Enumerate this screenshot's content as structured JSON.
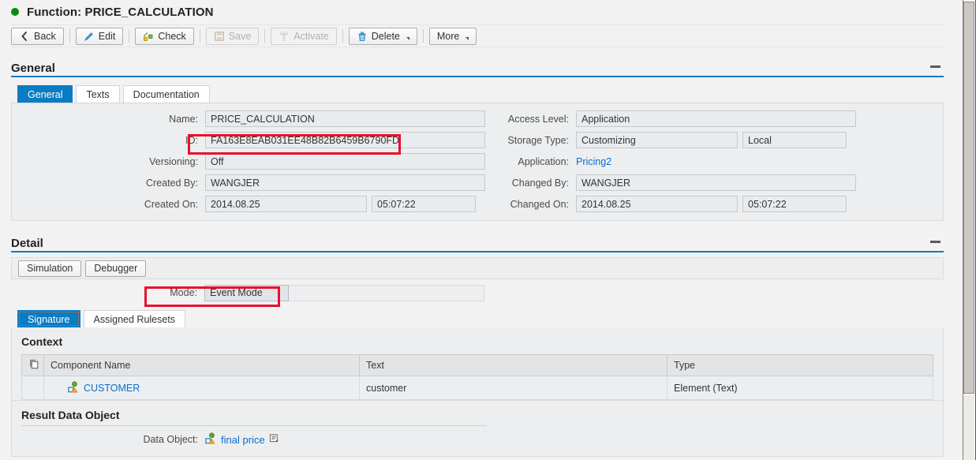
{
  "page": {
    "status_icon": "green-status-dot",
    "title": "Function: PRICE_CALCULATION"
  },
  "toolbar": {
    "buttons": [
      {
        "label": "Back",
        "icon": "back-chevron-icon",
        "disabled": false,
        "dropdown": false
      },
      {
        "label": "Edit",
        "icon": "pencil-icon",
        "disabled": false,
        "dropdown": false
      },
      {
        "label": "Check",
        "icon": "check-tool-icon",
        "disabled": false,
        "dropdown": false
      },
      {
        "label": "Save",
        "icon": "floppy-disk-icon",
        "disabled": true,
        "dropdown": false
      },
      {
        "label": "Activate",
        "icon": "activate-icon",
        "disabled": true,
        "dropdown": false
      },
      {
        "label": "Delete",
        "icon": "trash-icon",
        "disabled": false,
        "dropdown": true
      },
      {
        "label": "More",
        "icon": "none",
        "disabled": false,
        "dropdown": true
      }
    ]
  },
  "general_section": {
    "title": "General",
    "collapse_icon": "minus-icon",
    "tabs": [
      {
        "label": "General",
        "active": true
      },
      {
        "label": "Texts",
        "active": false
      },
      {
        "label": "Documentation",
        "active": false
      }
    ],
    "left_fields": {
      "name_label": "Name:",
      "name_value": "PRICE_CALCULATION",
      "id_label": "ID:",
      "id_value": "FA163E8EAB031EE48B82B6459B6790FD",
      "versioning_label": "Versioning:",
      "versioning_value": "Off",
      "created_by_label": "Created By:",
      "created_by_value": "WANGJER",
      "created_on_label": "Created On:",
      "created_on_date": "2014.08.25",
      "created_on_time": "05:07:22"
    },
    "right_fields": {
      "access_level_label": "Access Level:",
      "access_level_value": "Application",
      "storage_type_label": "Storage Type:",
      "storage_type_value": "Customizing",
      "storage_type_value2": "Local",
      "application_label": "Application:",
      "application_value": "Pricing2",
      "changed_by_label": "Changed By:",
      "changed_by_value": "WANGJER",
      "changed_on_label": "Changed On:",
      "changed_on_date": "2014.08.25",
      "changed_on_time": "05:07:22"
    }
  },
  "detail_section": {
    "title": "Detail",
    "collapse_icon": "minus-icon",
    "buttons": [
      {
        "label": "Simulation"
      },
      {
        "label": "Debugger"
      }
    ],
    "mode_label": "Mode:",
    "mode_value": "Event Mode",
    "tabs": [
      {
        "label": "Signature",
        "active": true,
        "focused": true
      },
      {
        "label": "Assigned Rulesets",
        "active": false,
        "focused": false
      }
    ],
    "context": {
      "title": "Context",
      "select_all_icon": "copy-columns-icon",
      "columns": [
        "",
        "Component Name",
        "Text",
        "Type"
      ],
      "rows": [
        {
          "icon": "data-object-icon",
          "component_name": "CUSTOMER",
          "text": "customer",
          "type": "Element (Text)"
        }
      ]
    },
    "result_data_object": {
      "title": "Result Data Object",
      "data_object_label": "Data Object:",
      "icon": "data-object-icon",
      "value": "final price",
      "value_suffix_icon": "value-help-icon"
    }
  },
  "colors": {
    "accent_blue": "#0a7cc4",
    "link_blue": "#0a6ed1",
    "highlight_red": "#e8112d",
    "status_green": "#0a8a0a",
    "panel_bg": "#edeeef"
  },
  "scrollbar": {
    "orientation": "vertical",
    "thumb_position_pct": 0
  }
}
